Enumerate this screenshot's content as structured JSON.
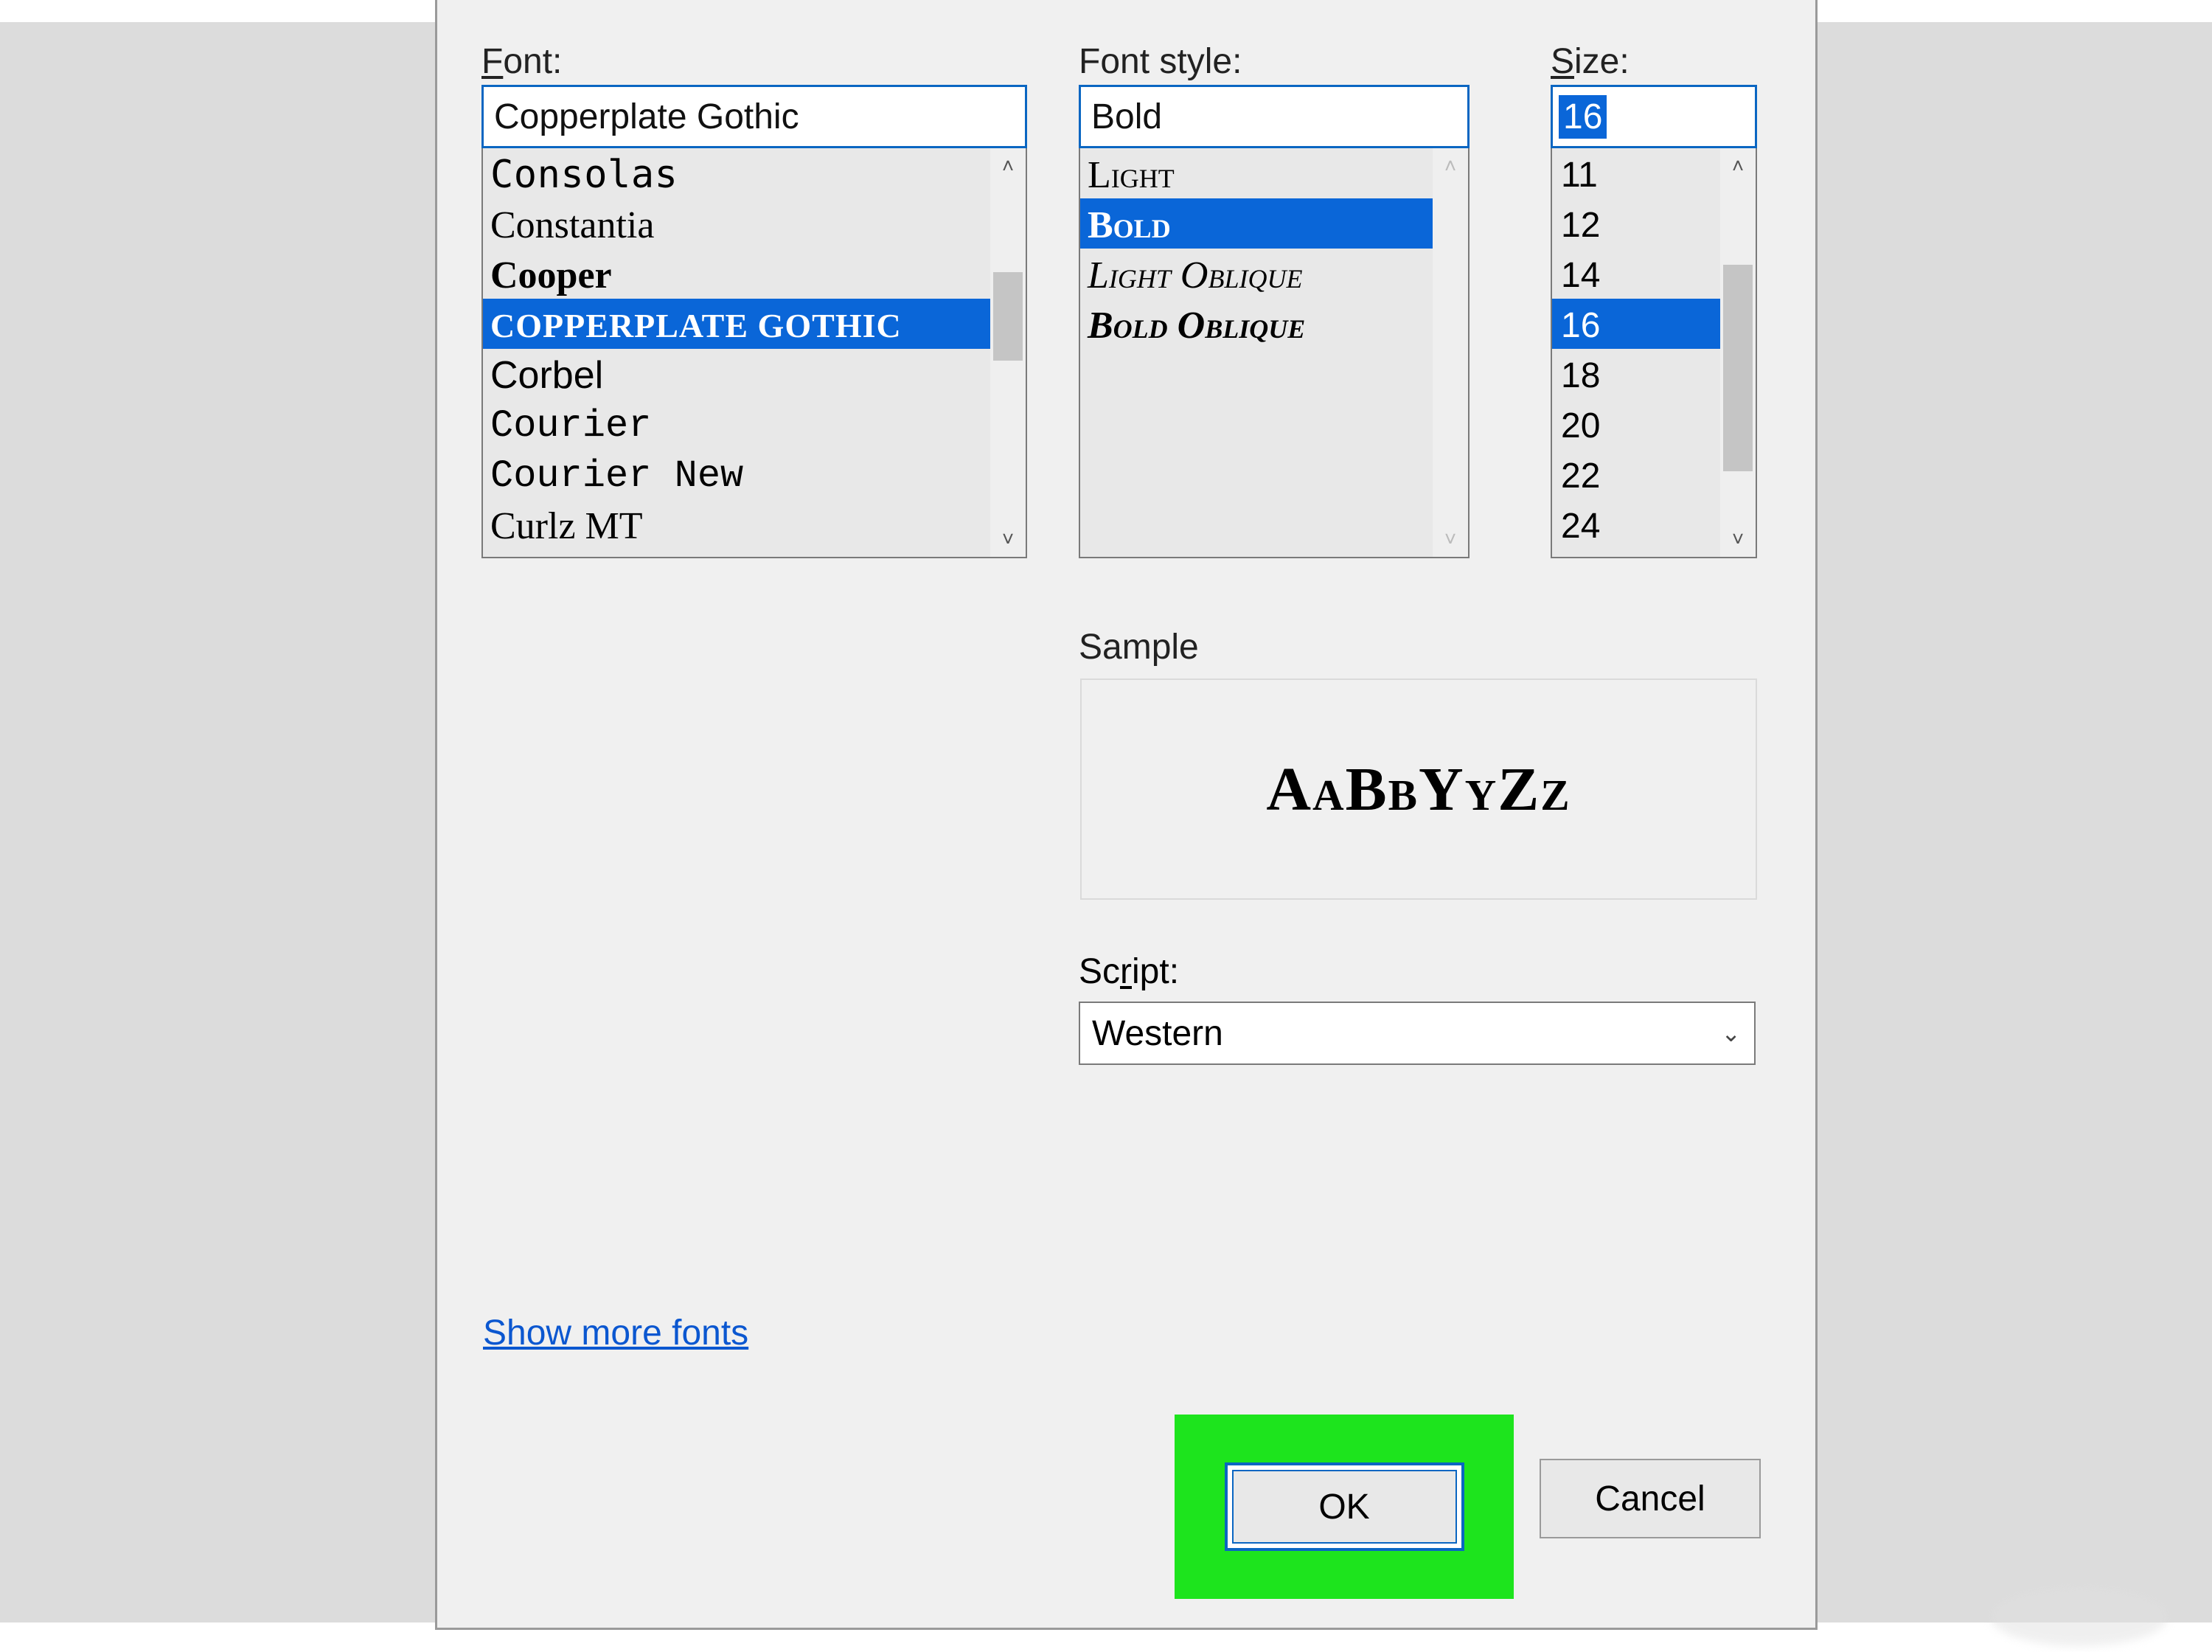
{
  "labels": {
    "font": "Font:",
    "fontStyle": "Font style:",
    "size": "Size:",
    "sample": "Sample",
    "script": "Script:",
    "moreFonts": "Show more fonts",
    "ok": "OK",
    "cancel": "Cancel"
  },
  "font": {
    "value": "Copperplate Gothic",
    "items": [
      {
        "label": "Consolas",
        "cls": "f-consolas"
      },
      {
        "label": "Constantia",
        "cls": "f-constantia"
      },
      {
        "label": "Cooper",
        "cls": "f-cooper"
      },
      {
        "label": "Copperplate Gothic",
        "cls": "f-copper",
        "selected": true
      },
      {
        "label": "Corbel",
        "cls": "f-corbel"
      },
      {
        "label": "Courier",
        "cls": "f-courier"
      },
      {
        "label": "Courier New",
        "cls": "f-couriernew"
      },
      {
        "label": "Curlz MT",
        "cls": "f-curlz"
      }
    ]
  },
  "fontStyle": {
    "value": "Bold",
    "items": [
      {
        "label": "Light",
        "cls": "fs-light"
      },
      {
        "label": "Bold",
        "cls": "fs-bold",
        "selected": true
      },
      {
        "label": "Light Oblique",
        "cls": "fs-lightobl"
      },
      {
        "label": "Bold Oblique",
        "cls": "fs-boldobl"
      }
    ]
  },
  "size": {
    "value": "16",
    "items": [
      {
        "label": "11"
      },
      {
        "label": "12"
      },
      {
        "label": "14"
      },
      {
        "label": "16",
        "selected": true
      },
      {
        "label": "18"
      },
      {
        "label": "20"
      },
      {
        "label": "22"
      },
      {
        "label": "24"
      }
    ]
  },
  "sampleText": "AaBbYyZz",
  "script": {
    "value": "Western"
  }
}
